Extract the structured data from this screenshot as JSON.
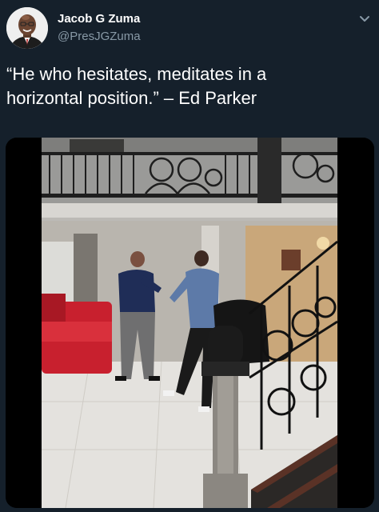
{
  "tweet": {
    "author_name": "Jacob G Zuma",
    "author_handle": "@PresJGZuma",
    "text": "“He who hesitates, meditates in a\nhorizontal position.” – Ed Parker"
  },
  "icons": {
    "menu": "chevron-down-icon",
    "avatar": "profile-avatar"
  },
  "colors": {
    "background": "#15202b",
    "primary_text": "#ffffff",
    "secondary_text": "#8899a6",
    "sofa": "#c8202e"
  }
}
